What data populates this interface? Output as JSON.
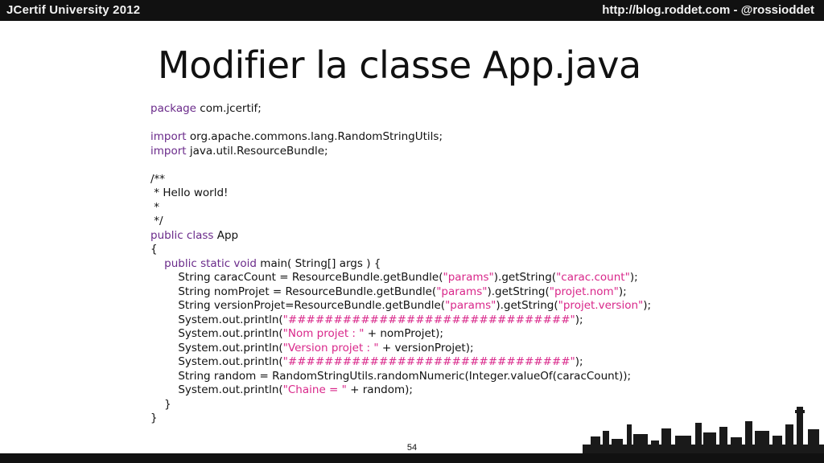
{
  "header": {
    "event": "JCertif University 2012",
    "blog": "http://blog.roddet.com  -  @rossioddet"
  },
  "slide": {
    "title": "Modifier la classe App.java",
    "page_number": "54"
  },
  "code_lines": [
    [
      {
        "t": "kw",
        "v": "package"
      },
      {
        "t": "pl",
        "v": " com.jcertif;"
      }
    ],
    [],
    [
      {
        "t": "kw",
        "v": "import"
      },
      {
        "t": "pl",
        "v": " org.apache.commons.lang.RandomStringUtils;"
      }
    ],
    [
      {
        "t": "kw",
        "v": "import"
      },
      {
        "t": "pl",
        "v": " java.util.ResourceBundle;"
      }
    ],
    [],
    [
      {
        "t": "pl",
        "v": "/**"
      }
    ],
    [
      {
        "t": "pl",
        "v": " * Hello world!"
      }
    ],
    [
      {
        "t": "pl",
        "v": " *"
      }
    ],
    [
      {
        "t": "pl",
        "v": " */"
      }
    ],
    [
      {
        "t": "kw",
        "v": "public class"
      },
      {
        "t": "pl",
        "v": " App"
      }
    ],
    [
      {
        "t": "pl",
        "v": "{"
      }
    ],
    [
      {
        "t": "kw",
        "v": "    public static void"
      },
      {
        "t": "pl",
        "v": " main( String[] args ) {"
      }
    ],
    [
      {
        "t": "pl",
        "v": "        String caracCount = ResourceBundle.getBundle("
      },
      {
        "t": "str",
        "v": "\"params\""
      },
      {
        "t": "pl",
        "v": ").getString("
      },
      {
        "t": "str",
        "v": "\"carac.count\""
      },
      {
        "t": "pl",
        "v": ");"
      }
    ],
    [
      {
        "t": "pl",
        "v": "        String nomProjet = ResourceBundle.getBundle("
      },
      {
        "t": "str",
        "v": "\"params\""
      },
      {
        "t": "pl",
        "v": ").getString("
      },
      {
        "t": "str",
        "v": "\"projet.nom\""
      },
      {
        "t": "pl",
        "v": ");"
      }
    ],
    [
      {
        "t": "pl",
        "v": "        String versionProjet=ResourceBundle.getBundle("
      },
      {
        "t": "str",
        "v": "\"params\""
      },
      {
        "t": "pl",
        "v": ").getString("
      },
      {
        "t": "str",
        "v": "\"projet.version\""
      },
      {
        "t": "pl",
        "v": ");"
      }
    ],
    [
      {
        "t": "pl",
        "v": "        System.out.println("
      },
      {
        "t": "str",
        "v": "\"###############################\""
      },
      {
        "t": "pl",
        "v": ");"
      }
    ],
    [
      {
        "t": "pl",
        "v": "        System.out.println("
      },
      {
        "t": "str",
        "v": "\"Nom projet : \""
      },
      {
        "t": "pl",
        "v": " + nomProjet);"
      }
    ],
    [
      {
        "t": "pl",
        "v": "        System.out.println("
      },
      {
        "t": "str",
        "v": "\"Version projet : \""
      },
      {
        "t": "pl",
        "v": " + versionProjet);"
      }
    ],
    [
      {
        "t": "pl",
        "v": "        System.out.println("
      },
      {
        "t": "str",
        "v": "\"###############################\""
      },
      {
        "t": "pl",
        "v": ");"
      }
    ],
    [
      {
        "t": "pl",
        "v": "        String random = RandomStringUtils.randomNumeric(Integer.valueOf(caracCount));"
      }
    ],
    [
      {
        "t": "pl",
        "v": "        System.out.println("
      },
      {
        "t": "str",
        "v": "\"Chaine = \""
      },
      {
        "t": "pl",
        "v": " + random);"
      }
    ],
    [
      {
        "t": "pl",
        "v": "    }"
      }
    ],
    [
      {
        "t": "pl",
        "v": "}"
      }
    ]
  ],
  "colors": {
    "keyword": "#6a2a8a",
    "string": "#d9278a",
    "bar": "#111111"
  }
}
